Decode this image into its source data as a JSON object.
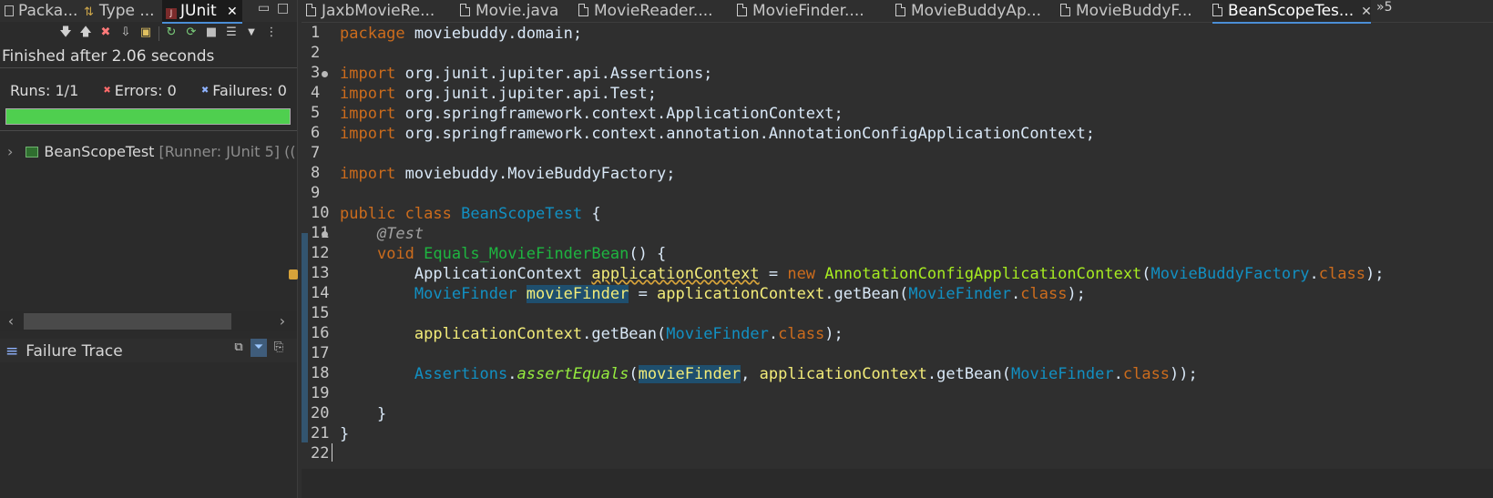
{
  "left_panel": {
    "tabs": [
      {
        "label": "Packa..."
      },
      {
        "label": "Type ..."
      },
      {
        "label": "JUnit",
        "close": "✕"
      }
    ],
    "window_controls": {
      "minimize": "▭",
      "maximize": "□"
    },
    "status": "Finished after 2.06 seconds",
    "counters": {
      "runs_label": "Runs:",
      "runs_value": "1/1",
      "errors_label": "Errors:",
      "errors_value": "0",
      "failures_label": "Failures:",
      "failures_value": "0"
    },
    "progress": {
      "fraction": 1.0,
      "color": "#4fcf4f"
    },
    "tree": [
      {
        "name": "BeanScopeTest",
        "runner": "[Runner: JUnit 5] (("
      }
    ],
    "failure_trace": {
      "title": "Failure Trace"
    }
  },
  "editor": {
    "tabs": [
      {
        "label": "JaxbMovieRe..."
      },
      {
        "label": "Movie.java"
      },
      {
        "label": "MovieReader...."
      },
      {
        "label": "MovieFinder...."
      },
      {
        "label": "MovieBuddyAp..."
      },
      {
        "label": "MovieBuddyF..."
      },
      {
        "label": "BeanScopeTes...",
        "active": true,
        "close": "✕"
      }
    ],
    "overflow": "»5",
    "line_numbers": [
      "1",
      "2",
      "3",
      "4",
      "5",
      "6",
      "7",
      "8",
      "9",
      "10",
      "11",
      "12",
      "13",
      "14",
      "15",
      "16",
      "17",
      "18",
      "19",
      "20",
      "21",
      "22"
    ],
    "code": {
      "l1": {
        "kw": "package",
        "rest": " moviebuddy.domain;"
      },
      "l3": {
        "kw": "import",
        "rest": " org.junit.jupiter.api.Assertions;"
      },
      "l4": {
        "kw": "import",
        "rest": " org.junit.jupiter.api.Test;"
      },
      "l5": {
        "kw": "import",
        "rest": " org.springframework.context.ApplicationContext;"
      },
      "l6": {
        "kw": "import",
        "rest": " org.springframework.context.annotation.AnnotationConfigApplicationContext;"
      },
      "l8": {
        "kw": "import",
        "rest": " moviebuddy.MovieBuddyFactory;"
      },
      "l10": {
        "kw1": "public",
        "kw2": "class",
        "cls": "BeanScopeTest",
        "rest": " {"
      },
      "l11": {
        "ann": "@Test"
      },
      "l12": {
        "kw": "void",
        "mth": "Equals_MovieFinderBean",
        "rest": "() {"
      },
      "l13": {
        "t1": "ApplicationContext",
        "v1": "applicationContext",
        "eq": " = ",
        "kw": "new",
        "c1": "AnnotationConfigApplicationContext",
        "p1": "(",
        "c2": "MovieBuddyFactory",
        "dot": ".",
        "kw2": "class",
        "end": ");"
      },
      "l14": {
        "t1": "MovieFinder",
        "v1": "movieFinder",
        "eq": " = ",
        "v2": "applicationContext",
        "m": ".getBean(",
        "c1": "MovieFinder",
        "dot": ".",
        "kw": "class",
        "end": ");"
      },
      "l16": {
        "v1": "applicationContext",
        "m": ".getBean(",
        "c1": "MovieFinder",
        "dot": ".",
        "kw": "class",
        "end": ");"
      },
      "l18": {
        "c0": "Assertions",
        "dot0": ".",
        "sm": "assertEquals",
        "p": "(",
        "v1": "movieFinder",
        "comma": ", ",
        "v2": "applicationContext",
        "m": ".getBean(",
        "c1": "MovieFinder",
        "dot": ".",
        "kw": "class",
        "end": "));"
      },
      "l20": {
        "rest": "}"
      },
      "l21": {
        "rest": "}"
      }
    }
  }
}
